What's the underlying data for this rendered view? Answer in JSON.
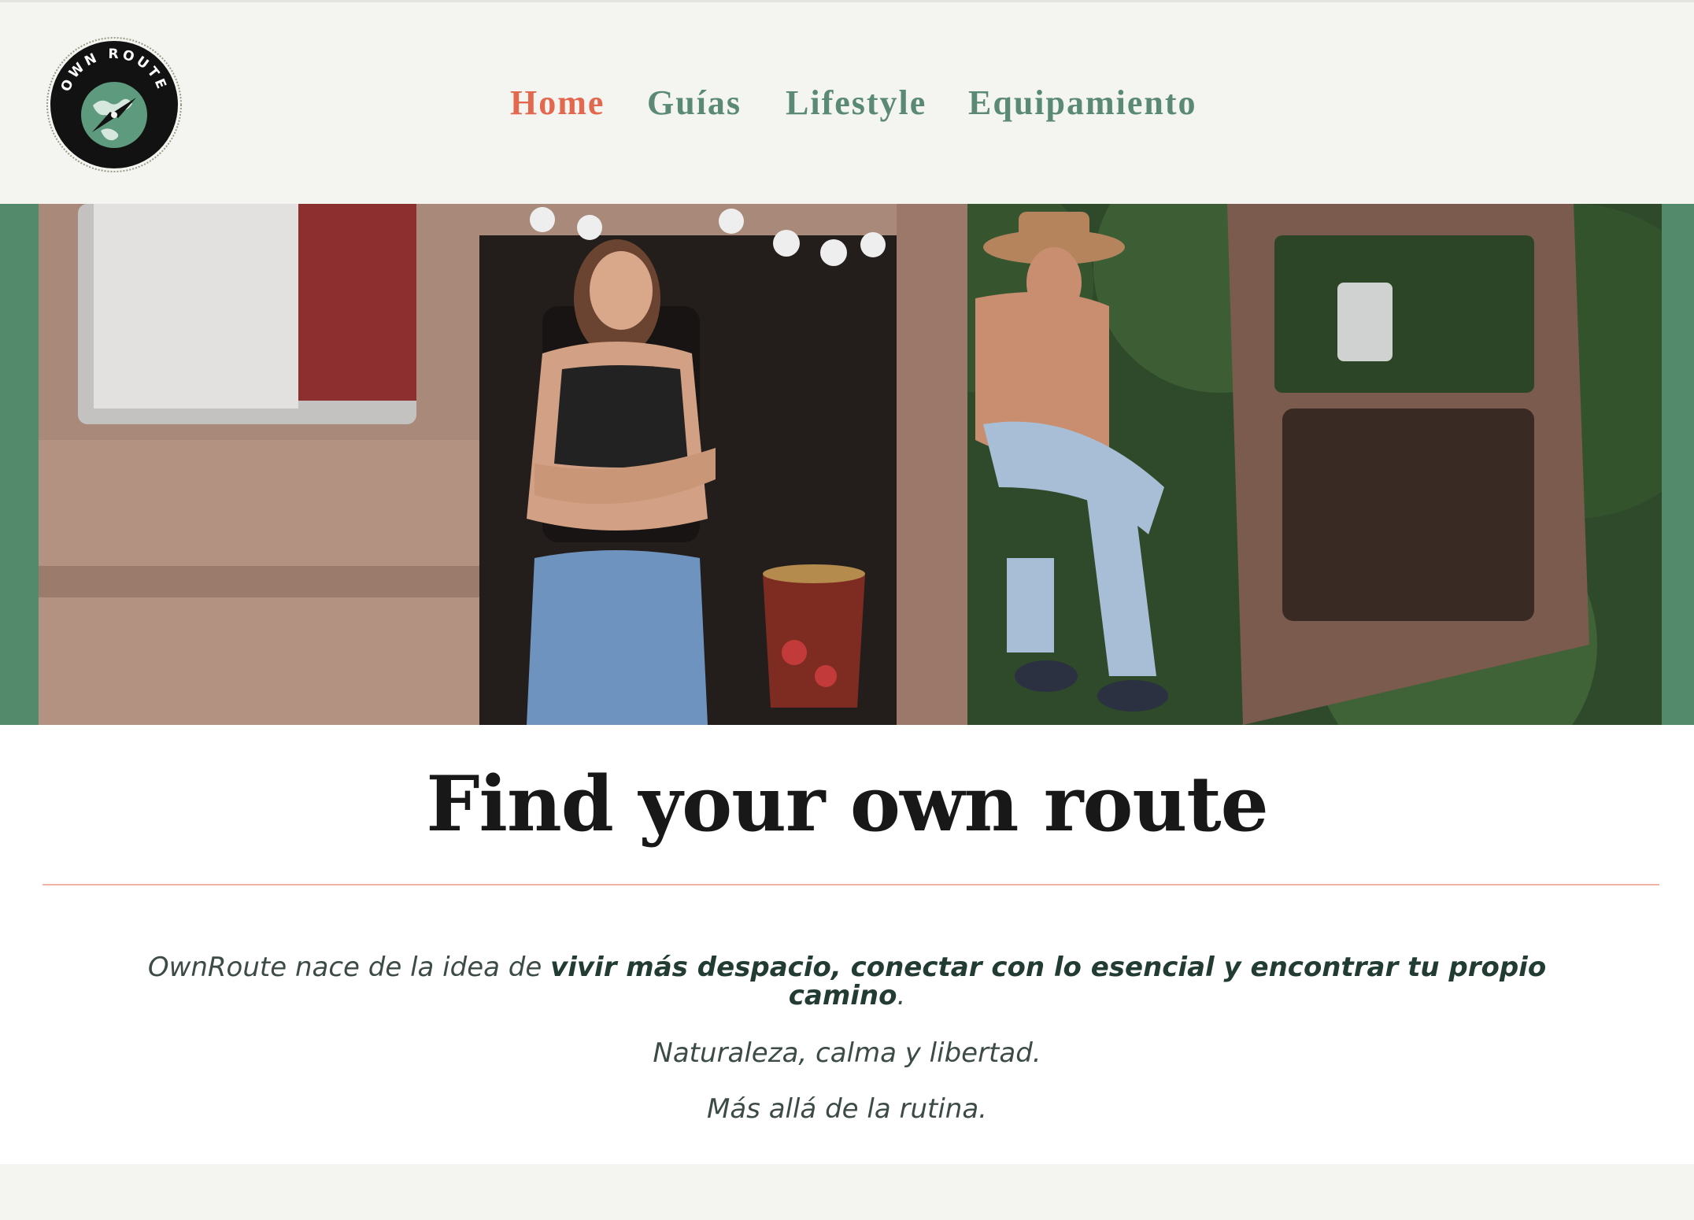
{
  "header": {
    "logo_text": "OWN ROUTE",
    "nav": [
      {
        "label": "Home",
        "active": true
      },
      {
        "label": "Guías",
        "active": false
      },
      {
        "label": "Lifestyle",
        "active": false
      },
      {
        "label": "Equipamiento",
        "active": false
      }
    ]
  },
  "hero": {
    "image_name": "hero-photo"
  },
  "main": {
    "title": "Find your own route",
    "intro_before": "OwnRoute nace de la idea de ",
    "intro_bold": "vivir más despacio, conectar con lo esencial y encontrar tu propio camino",
    "intro_after": ".",
    "line2": "Naturaleza, calma y libertad.",
    "line3": "Más allá de la rutina."
  },
  "colors": {
    "accent": "#e2694f",
    "nav_green": "#5a8a76",
    "band_green": "#548a6c",
    "background": "#f4f4f0"
  }
}
